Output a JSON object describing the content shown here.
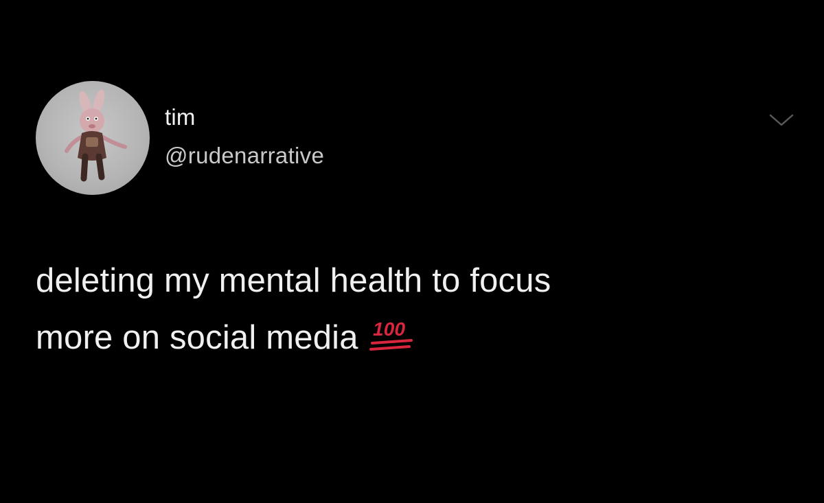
{
  "tweet": {
    "author": {
      "display_name": "tim",
      "handle": "@rudenarrative",
      "avatar_icon": "bunny-avatar-icon"
    },
    "text_lines": [
      "deleting my mental health to focus",
      "more on social media"
    ],
    "emoji": {
      "text": "100",
      "icon": "hundred-points-emoji",
      "color": "#d7263d"
    },
    "menu_icon": "chevron-down-icon"
  },
  "colors": {
    "background": "#000000",
    "primary_text": "#f0f0f0",
    "secondary_text": "#c9c9c9",
    "chevron": "#5a5a5a"
  }
}
